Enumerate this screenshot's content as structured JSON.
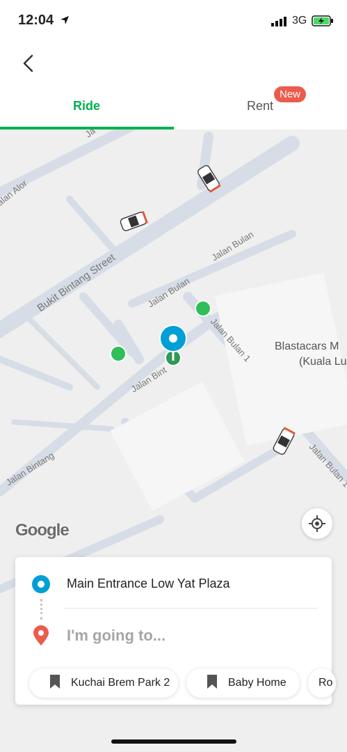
{
  "status_bar": {
    "time": "12:04",
    "network": "3G"
  },
  "tabs": {
    "ride": "Ride",
    "rent": "Rent",
    "new_badge": "New"
  },
  "map": {
    "streets": {
      "bukit_bintang": "Bukit Bintang Street",
      "jalan_bulan_a": "Jalan Bulan",
      "jalan_bulan_b": "Jalan Bulan",
      "jalan_bulan_1a": "Jalan Bulan 1",
      "jalan_bulan_1b": "Jalan Bulan 1",
      "jalan_bintang_a": "Jalan Bint",
      "jalan_bintang_b": "Jalan Bintang",
      "jalan_alor": "alan Alor",
      "ja_top": "Ja"
    },
    "place_line1": "Blastacars M",
    "place_line2": "(Kuala Lu",
    "attribution": "Google"
  },
  "trip": {
    "pickup": "Main Entrance Low Yat Plaza",
    "destination_placeholder": "I'm going to..."
  },
  "saved_places": [
    {
      "label": "Kuchai Brem Park 2"
    },
    {
      "label": "Baby Home"
    },
    {
      "label": "Ro"
    }
  ],
  "colors": {
    "accent": "#00b14f",
    "pickup": "#00a0d6",
    "destination": "#ec5b4b"
  }
}
